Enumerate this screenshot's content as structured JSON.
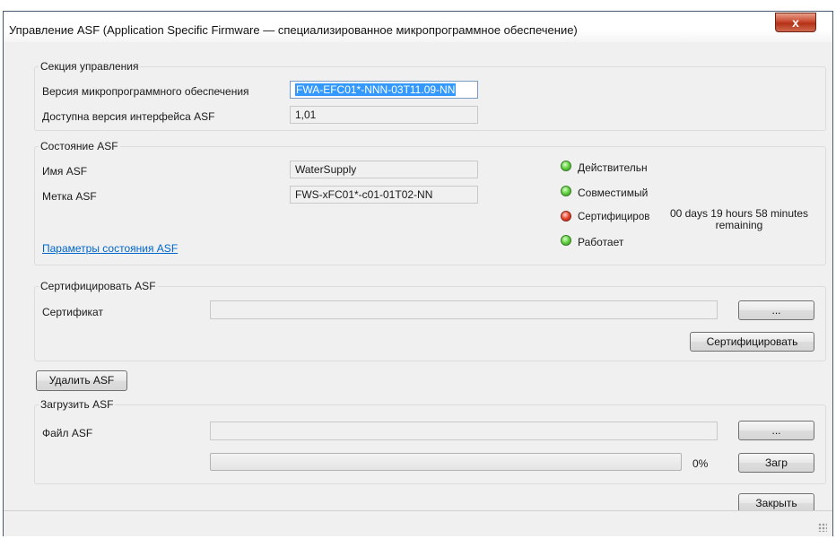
{
  "window": {
    "title": "Управление ASF (Application Specific Firmware — специализированное микропрограммное обеспечение)",
    "close_glyph": "x"
  },
  "control_section": {
    "label": "Секция управления",
    "firmware_version_label": "Версия микропрограммного обеспечения",
    "firmware_version_value": "FWA-EFC01*-NNN-03T11.09-NN",
    "interface_version_label": "Доступна версия интерфейса ASF",
    "interface_version_value": "1,01"
  },
  "status_section": {
    "label": "Состояние ASF",
    "name_label": "Имя ASF",
    "name_value": "WaterSupply",
    "tag_label": "Метка ASF",
    "tag_value": "FWS-xFC01*-c01-01T02-NN",
    "params_link": "Параметры состояния ASF",
    "indicators": [
      {
        "label": "Действительн",
        "color": "green"
      },
      {
        "label": "Совместимый",
        "color": "green"
      },
      {
        "label": "Сертифициров",
        "color": "red"
      },
      {
        "label": "Работает",
        "color": "green"
      }
    ],
    "remaining_text": "00 days 19 hours 58 minutes remaining"
  },
  "certify_section": {
    "label": "Сертифицировать ASF",
    "certificate_label": "Сертификат",
    "certificate_value": "",
    "browse_label": "...",
    "certify_button": "Сертифицировать"
  },
  "delete_button": "Удалить ASF",
  "load_section": {
    "label": "Загрузить ASF",
    "file_label": "Файл ASF",
    "file_value": "",
    "browse_label": "...",
    "progress_percent": 0,
    "progress_text": "0%",
    "load_button": "Загр"
  },
  "close_button": "Закрыть",
  "colors": {
    "led_green": "#5fcf3c",
    "led_red": "#e8452c",
    "selection": "#3399ff",
    "link": "#0066cc",
    "close_button": "#c8492f"
  }
}
